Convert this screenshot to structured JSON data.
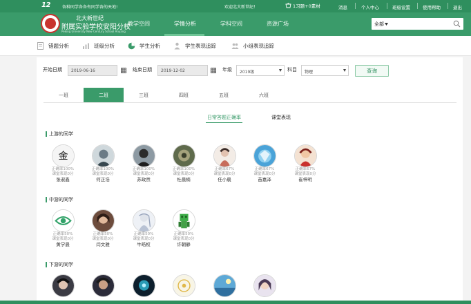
{
  "topbar": {
    "logo_num": "12",
    "slogan": "教学同享 教 各 为 同 教 为 ",
    "welcome": "欢迎北大新世纪！",
    "cart": "1习题+0素材",
    "links": [
      "消息",
      "个人中心",
      "班级设置",
      "使用帮助",
      "退出"
    ]
  },
  "school": {
    "name_line1": "北大新世纪",
    "name_line2": "附属实验学校安阳分校",
    "name_en": "Peking University New Century School Anyang"
  },
  "nav": {
    "items": [
      "教学空间",
      "学情分析",
      "学科空间",
      "资源广场"
    ],
    "active_index": 1
  },
  "search": {
    "scope": "全部",
    "placeholder": ""
  },
  "subtabs": [
    "错题分析",
    "班级分析",
    "学生分析",
    "学生表现追踪",
    "小组表现追踪"
  ],
  "filters": {
    "start_label": "开始日期",
    "start_value": "2019-06-16",
    "end_label": "结束日期",
    "end_value": "2019-12-02",
    "grade_label": "年级",
    "grade_value": "2019级",
    "subject_label": "科目",
    "subject_value": "物理",
    "query_label": "查询"
  },
  "classes": [
    "一班",
    "二班",
    "三班",
    "四班",
    "五班",
    "六班"
  ],
  "active_class_index": 1,
  "metric_tabs": [
    "日常答题正确率",
    "课堂表现"
  ],
  "groups": [
    {
      "title": "上游的同学",
      "students": [
        {
          "name": "张淑鑫",
          "accuracy": "正确率100%",
          "performance": "课堂表现0分"
        },
        {
          "name": "何正浩",
          "accuracy": "正确率100%",
          "performance": "课堂表现0分"
        },
        {
          "name": "苏政然",
          "accuracy": "正确率100%",
          "performance": "课堂表现0分"
        },
        {
          "name": "杜晨楠",
          "accuracy": "正确率100%",
          "performance": "课堂表现0分"
        },
        {
          "name": "任小晨",
          "accuracy": "正确率67%",
          "performance": "课堂表现0分"
        },
        {
          "name": "苗嘉泽",
          "accuracy": "正确率67%",
          "performance": "课堂表现0分"
        },
        {
          "name": "崔梓明",
          "accuracy": "正确率67%",
          "performance": "课堂表现0分"
        }
      ]
    },
    {
      "title": "中游的同学",
      "students": [
        {
          "name": "黄学晨",
          "accuracy": "正确率50%",
          "performance": "课堂表现0分"
        },
        {
          "name": "闫文雅",
          "accuracy": "正确率50%",
          "performance": "课堂表现0分"
        },
        {
          "name": "牛皓权",
          "accuracy": "正确率50%",
          "performance": "课堂表现0分"
        },
        {
          "name": "许朝静",
          "accuracy": "正确率50%",
          "performance": "课堂表现0分"
        }
      ]
    },
    {
      "title": "下游的同学",
      "students": [
        {
          "name": ""
        },
        {
          "name": ""
        },
        {
          "name": ""
        },
        {
          "name": ""
        },
        {
          "name": ""
        },
        {
          "name": ""
        }
      ]
    }
  ],
  "colors": {
    "brand_green": "#3a9b6a",
    "header_dark": "#2f8f5e"
  }
}
